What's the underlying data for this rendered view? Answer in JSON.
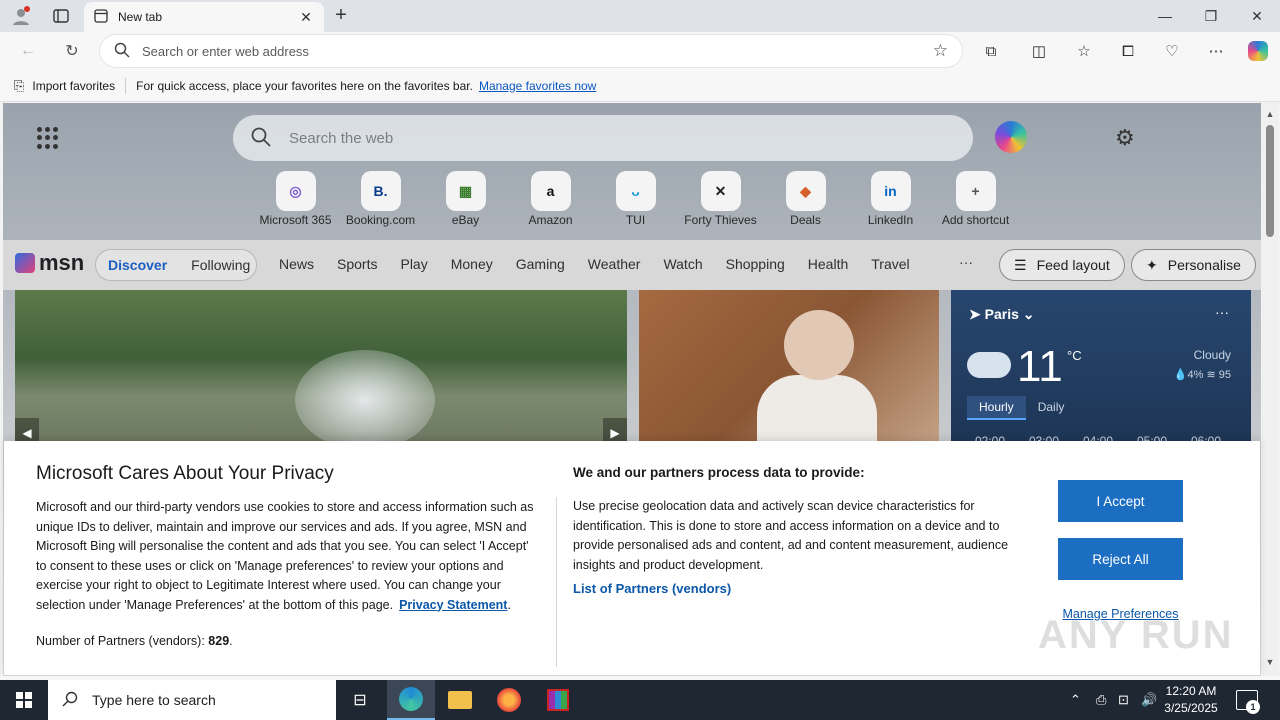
{
  "browser": {
    "tab_title": "New tab",
    "address_placeholder": "Search or enter web address",
    "favorites_bar": {
      "import_label": "Import favorites",
      "hint": "For quick access, place your favorites here on the favorites bar.",
      "manage_link": "Manage favorites now"
    }
  },
  "newtab": {
    "search_placeholder": "Search the web",
    "shortcuts": [
      {
        "label": "Microsoft 365",
        "icon": "office-icon",
        "glyph": "◎",
        "color": "#7b5cd6"
      },
      {
        "label": "Booking.com",
        "icon": "booking-icon",
        "glyph": "B.",
        "color": "#0b3b8c"
      },
      {
        "label": "eBay",
        "icon": "ebay-icon",
        "glyph": "▦",
        "color": "#3a7d2a"
      },
      {
        "label": "Amazon",
        "icon": "amazon-icon",
        "glyph": "a",
        "color": "#111111"
      },
      {
        "label": "TUI",
        "icon": "tui-icon",
        "glyph": "ᴗ",
        "color": "#1a9ad6"
      },
      {
        "label": "Forty Thieves",
        "icon": "swords-icon",
        "glyph": "✕",
        "color": "#222222"
      },
      {
        "label": "Deals",
        "icon": "tag-icon",
        "glyph": "◆",
        "color": "#d6622a"
      },
      {
        "label": "LinkedIn",
        "icon": "linkedin-icon",
        "glyph": "in",
        "color": "#0a66c2"
      },
      {
        "label": "Add shortcut",
        "icon": "plus-icon",
        "glyph": "+",
        "color": "#555555"
      }
    ]
  },
  "msn": {
    "logo": "msn",
    "feed_tabs": [
      "Discover",
      "Following"
    ],
    "categories": [
      "News",
      "Sports",
      "Play",
      "Money",
      "Gaming",
      "Weather",
      "Watch",
      "Shopping",
      "Health",
      "Travel"
    ],
    "more": "···",
    "feed_layout_label": "Feed layout",
    "personalise_label": "Personalise"
  },
  "weather": {
    "city": "Paris",
    "temperature": "11",
    "unit": "°C",
    "condition": "Cloudy",
    "precip": "4%",
    "humidity": "95",
    "tabs": [
      "Hourly",
      "Daily"
    ],
    "hours": [
      "02:00",
      "03:00",
      "04:00",
      "05:00",
      "06:00"
    ]
  },
  "privacy": {
    "title": "Microsoft Cares About Your Privacy",
    "body": "Microsoft and our third-party vendors use cookies to store and access information such as unique IDs to deliver, maintain and improve our services and ads. If you agree, MSN and Microsoft Bing will personalise the content and ads that you see. You can select 'I Accept' to consent to these uses or click on 'Manage preferences' to review your options and exercise your right to object to Legitimate Interest where used.  You can change your selection under 'Manage Preferences' at the bottom of this page.",
    "privacy_link": "Privacy Statement",
    "partners_label": "Number of Partners (vendors):",
    "partners_count": "829",
    "heading2": "We and our partners process data to provide:",
    "body2": "Use precise geolocation data and actively scan device characteristics for identification. This is done to store and access information on a device and to provide personalised ads and content, ad and content measurement, audience insights and product development.",
    "list_partners": "List of Partners (vendors)",
    "accept": "I Accept",
    "reject": "Reject All",
    "manage": "Manage Preferences"
  },
  "watermark": "ANY RUN",
  "taskbar": {
    "search_placeholder": "Type here to search",
    "time": "12:20 AM",
    "date": "3/25/2025",
    "notification_count": "1"
  }
}
